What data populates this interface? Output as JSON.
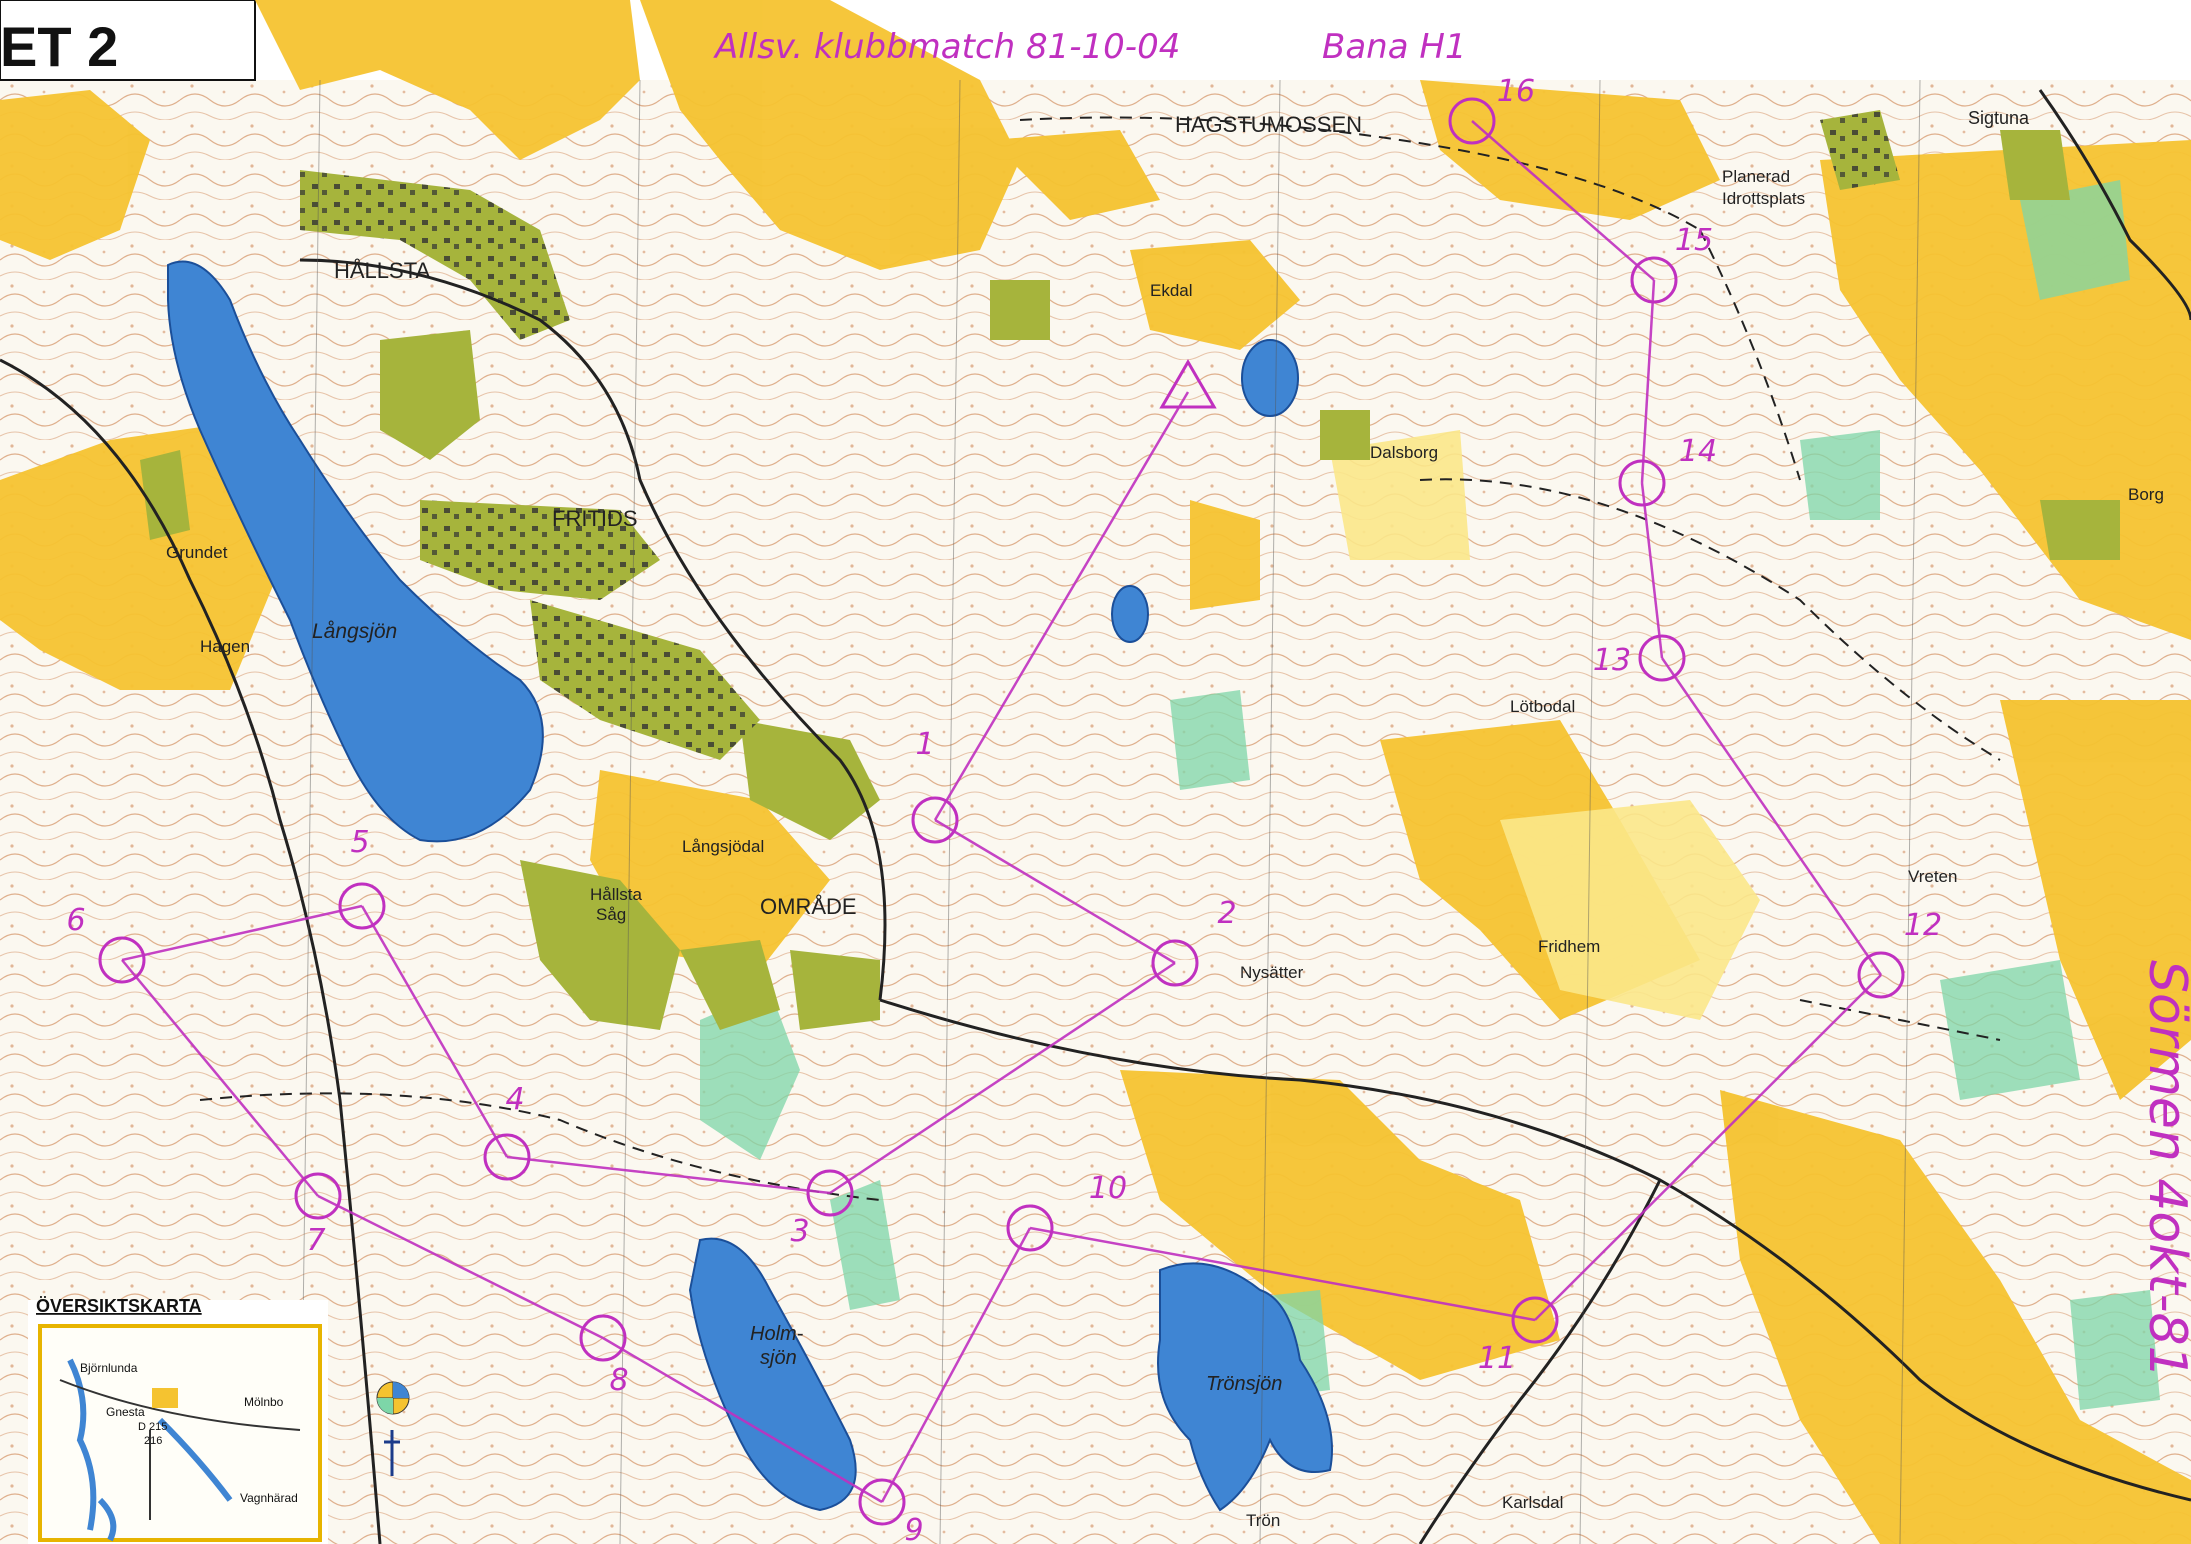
{
  "header": {
    "sheet_label": "ET 2",
    "event_note": "Allsv. klubbmatch 81-10-04",
    "course_note": "Bana H1"
  },
  "place_names": {
    "hagstumossen": "HAGSTUMOSSEN",
    "sigtuna": "Sigtuna",
    "planerad": "Planerad",
    "idrottsplats": "Idrottsplats",
    "hallsta": "HÅLLSTA",
    "ekdal": "Ekdal",
    "dalsborg": "Dalsborg",
    "borg": "Borg",
    "fritids": "FRITIDS",
    "grundet": "Grundet",
    "hagen": "Hagen",
    "langsjon": "Långsjön",
    "lotbodal": "Lötbodal",
    "langsjodal": "Långsjödal",
    "omrade": "OMRÅDE",
    "hallsta_sag_1": "Hållsta",
    "hallsta_sag_2": "Såg",
    "nysatter": "Nysätter",
    "fridhem": "Fridhem",
    "vreten": "Vreten",
    "holmsjon_1": "Holm-",
    "holmsjon_2": "sjön",
    "tronsjon": "Trönsjön",
    "tron": "Trön",
    "karlsdal": "Karlsdal"
  },
  "overview": {
    "title": "ÖVERSIKTSKARTA",
    "bjornlunda": "Björnlunda",
    "gnesta": "Gnesta",
    "molnbo": "Mölnbo",
    "road_1": "D 215",
    "road_2": "216",
    "vagnharad": "Vagnhärad"
  },
  "margin_note": "Sörmen 4okt-81",
  "colors": {
    "field_yellow": "#f5c330",
    "settlement_olive": "#a6b43c",
    "water_blue": "#3f85d3",
    "course_magenta": "#c030c0",
    "contour_brown": "#c8743c"
  },
  "course": {
    "controls": [
      {
        "id": "1",
        "label": "1"
      },
      {
        "id": "2",
        "label": "2"
      },
      {
        "id": "3",
        "label": "3"
      },
      {
        "id": "4",
        "label": "4"
      },
      {
        "id": "5",
        "label": "5"
      },
      {
        "id": "6",
        "label": "6"
      },
      {
        "id": "7",
        "label": "7"
      },
      {
        "id": "8",
        "label": "8"
      },
      {
        "id": "9",
        "label": "9"
      },
      {
        "id": "10",
        "label": "10"
      },
      {
        "id": "11",
        "label": "11"
      },
      {
        "id": "12",
        "label": "12"
      },
      {
        "id": "13",
        "label": "13"
      },
      {
        "id": "14",
        "label": "14"
      },
      {
        "id": "15",
        "label": "15"
      },
      {
        "id": "16",
        "label": "16"
      }
    ]
  }
}
